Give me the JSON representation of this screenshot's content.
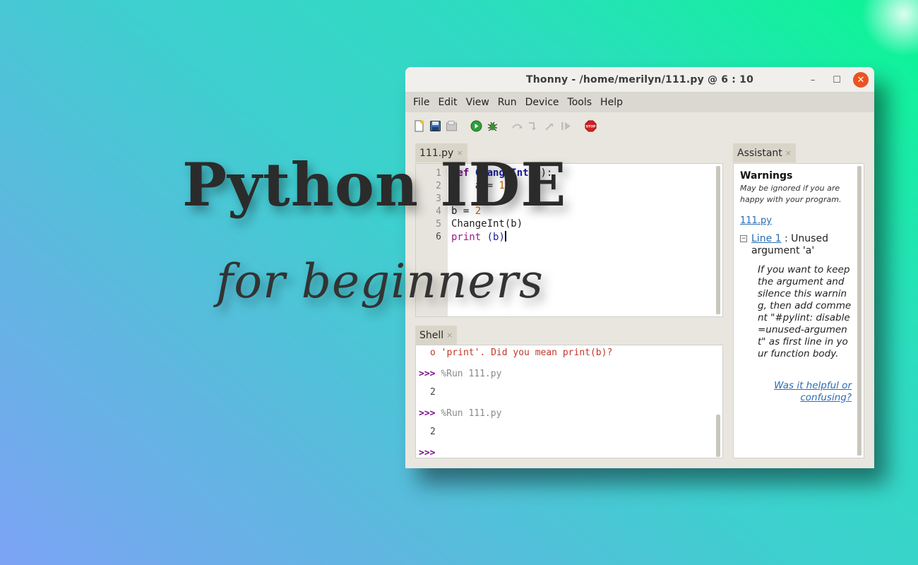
{
  "window": {
    "title": "Thonny  -  /home/merilyn/111.py  @  6 : 10",
    "minimize": "–",
    "maximize": "☐",
    "close": "✕"
  },
  "menu": [
    "File",
    "Edit",
    "View",
    "Run",
    "Device",
    "Tools",
    "Help"
  ],
  "toolbar": {
    "icons": [
      "new-file-icon",
      "save-icon",
      "open-icon",
      "run-icon",
      "debug-icon",
      "step-over-icon",
      "step-into-icon",
      "step-out-icon",
      "resume-icon",
      "stop-icon"
    ],
    "stop_label": "STOP"
  },
  "editor": {
    "tab_label": "111.py",
    "tab_close": "×",
    "line_numbers": [
      "1",
      "2",
      "3",
      "4",
      "5",
      "6"
    ],
    "lines": {
      "l1_kw": "def",
      "l1_fn": "ChangeInt",
      "l1_rest": "(a):",
      "l2_indent": "    a = ",
      "l2_num": "10",
      "l4_a": "b = ",
      "l4_num": "2",
      "l5": "ChangeInt(b)",
      "l6_bi": "print",
      "l6_par": " (b)"
    }
  },
  "shell": {
    "tab_label": "Shell",
    "tab_close": "×",
    "error_line": "o 'print'. Did you mean print(b)?",
    "prompt": ">>>",
    "run_cmd_1": "%Run 111.py",
    "output_1": "2",
    "run_cmd_2": "%Run 111.py",
    "output_2": "2"
  },
  "assistant": {
    "tab_label": "Assistant",
    "tab_close": "×",
    "heading": "Warnings",
    "subtitle": "May be ignored if you are happy with your program.",
    "file_link": "111.py",
    "toggle": "−",
    "line_link": "Line 1",
    "warning_text": " : Unused argument 'a'",
    "body": "If you want to keep the argument and silence this warning, then add comment \"#pylint: disable=unused-argument\" as first line in your function body.",
    "feedback": "Was it helpful or confusing?"
  },
  "overlay": {
    "title": "Python IDE",
    "subtitle": "for beginners"
  }
}
